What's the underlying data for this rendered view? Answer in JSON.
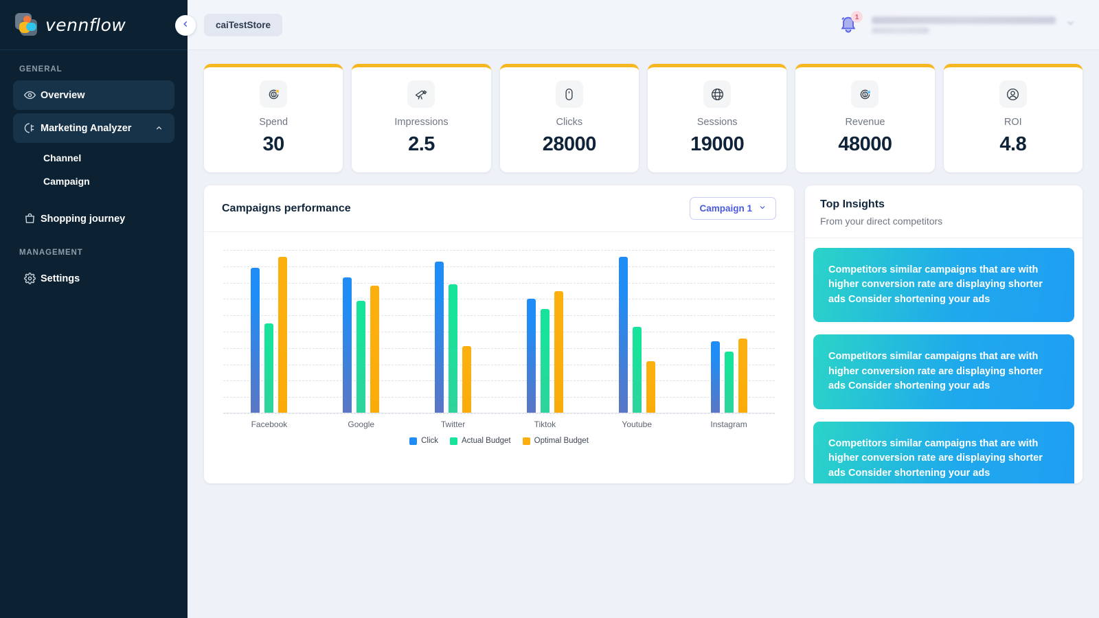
{
  "brand": {
    "name": "vennflow",
    "logo_icon": "vennflow-logo-icon"
  },
  "sidebar": {
    "sections": [
      {
        "label": "GENERAL",
        "items": [
          {
            "label": "Overview",
            "icon": "eye-icon",
            "active": true,
            "expandable": false
          },
          {
            "label": "Marketing Analyzer",
            "icon": "pie-chart-icon",
            "active": true,
            "expandable": true,
            "chevron": "chevron-up-icon",
            "children": [
              {
                "label": "Channel"
              },
              {
                "label": "Campaign"
              }
            ]
          },
          {
            "label": "Shopping journey",
            "icon": "bag-icon",
            "active": false,
            "expandable": false
          }
        ]
      },
      {
        "label": "MANAGEMENT",
        "items": [
          {
            "label": "Settings",
            "icon": "gear-icon",
            "active": false,
            "expandable": false
          }
        ]
      }
    ],
    "collapse_icon": "chevron-left-icon"
  },
  "topbar": {
    "store_chip": "caiTestStore",
    "bell_icon": "bell-icon",
    "notification_count": "1",
    "user_caret_icon": "chevron-down-icon"
  },
  "kpis": [
    {
      "label": "Spend",
      "value": "30",
      "icon": "dollar-up-icon",
      "accent": "#f6b81e"
    },
    {
      "label": "Impressions",
      "value": "2.5",
      "icon": "telescope-icon",
      "accent": "#f6b81e"
    },
    {
      "label": "Clicks",
      "value": "28000",
      "icon": "mouse-icon",
      "accent": "#f6b81e"
    },
    {
      "label": "Sessions",
      "value": "19000",
      "icon": "globe-icon",
      "accent": "#f6b81e"
    },
    {
      "label": "Revenue",
      "value": "48000",
      "icon": "dollar-down-icon",
      "accent": "#f6b81e"
    },
    {
      "label": "ROI",
      "value": "4.8",
      "icon": "user-circle-icon",
      "accent": "#f6b81e"
    }
  ],
  "chart_panel": {
    "title": "Campaigns performance",
    "campaign_selected": "Campaign 1",
    "campaign_caret_icon": "chevron-down-icon"
  },
  "chart_data": {
    "type": "bar",
    "title": "Campaigns performance",
    "xlabel": "",
    "ylabel": "",
    "grid": true,
    "grid_lines": 10,
    "ylim": [
      0,
      100
    ],
    "legend_position": "bottom",
    "categories": [
      "Facebook",
      "Google",
      "Twitter",
      "Tiktok",
      "Youtube",
      "Instagram"
    ],
    "series": [
      {
        "name": "Click",
        "color": "#1f8df5",
        "values": [
          89,
          83,
          93,
          70,
          96,
          44
        ]
      },
      {
        "name": "Actual Budget",
        "color": "#17e49a",
        "values": [
          55,
          69,
          79,
          64,
          53,
          38
        ]
      },
      {
        "name": "Optimal Budget",
        "color": "#fcb010",
        "values": [
          96,
          78,
          41,
          75,
          32,
          46
        ]
      }
    ]
  },
  "insights": {
    "title": "Top Insights",
    "subtitle": "From your direct competitors",
    "items": [
      {
        "text": "Competitors similar campaigns that are with higher conversion rate are displaying shorter ads Consider shortening your ads"
      },
      {
        "text": "Competitors similar campaigns that are with higher conversion rate are displaying shorter ads Consider shortening your ads"
      },
      {
        "text": "Competitors similar campaigns that are with higher conversion rate are displaying shorter ads Consider shortening your ads"
      }
    ]
  },
  "colors": {
    "sidebar_bg": "#0c2233",
    "page_bg": "#eef1f7",
    "kpi_accent": "#f6b81e",
    "brand_blue": "#4a5ae0",
    "series_click": "#1f8df5",
    "series_actual": "#17e49a",
    "series_optimal": "#fcb010",
    "insight_gradient_from": "#2bd4c8",
    "insight_gradient_to": "#1f9ef3"
  }
}
